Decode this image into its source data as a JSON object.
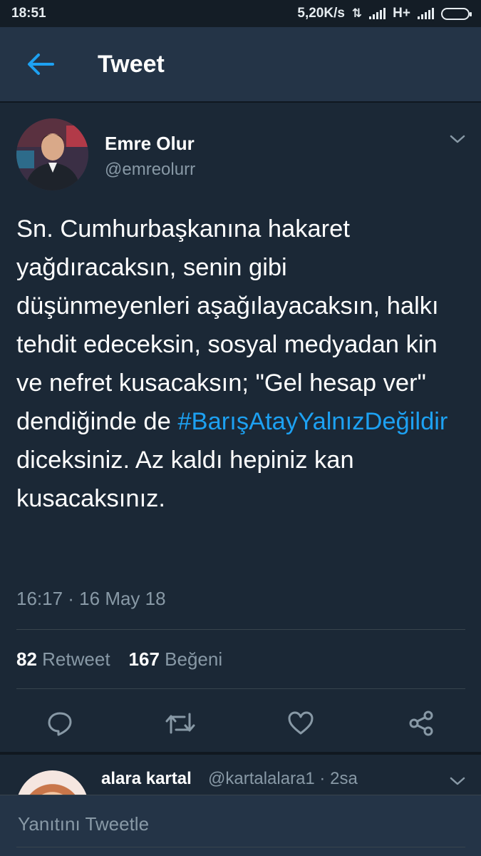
{
  "status_bar": {
    "time": "18:51",
    "network_speed": "5,20K/s",
    "network_type": "H+"
  },
  "header": {
    "title": "Tweet"
  },
  "tweet": {
    "author_name": "Emre Olur",
    "author_handle": "@emreolurr",
    "text_before_hashtag": "Sn. Cumhurbaşkanına hakaret yağdıracaksın, senin gibi düşünmeyenleri aşağılayacaksın, halkı tehdit edeceksin, sosyal medyadan kin ve nefret kusacaksın; \"Gel hesap ver\" dendiğinde de ",
    "hashtag": "#BarışAtayYalnızDeğildir",
    "text_after_hashtag": " diceksiniz. Az kaldı hepiniz kan kusacaksınız.",
    "timestamp": "16:17 · 16 May 18",
    "retweet_count": "82",
    "retweet_label": "Retweet",
    "like_count": "167",
    "like_label": "Beğeni"
  },
  "reply_preview": {
    "name": "alara kartal",
    "handle_time": "@kartalalara1 · 2sa"
  },
  "composer": {
    "placeholder": "Yanıtını Tweetle"
  },
  "colors": {
    "background": "#1b2836",
    "header": "#243447",
    "accent": "#1da1f2",
    "secondary_text": "#8899a6"
  }
}
